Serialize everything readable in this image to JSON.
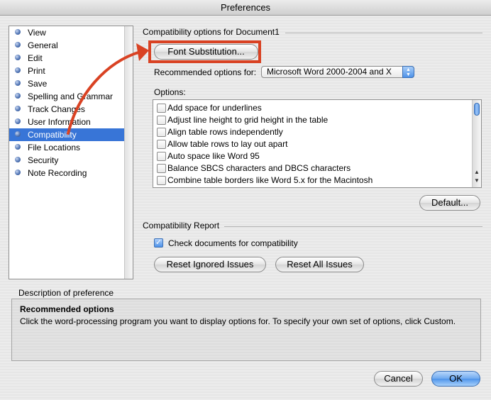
{
  "window": {
    "title": "Preferences"
  },
  "sidebar": {
    "items": [
      {
        "label": "View"
      },
      {
        "label": "General"
      },
      {
        "label": "Edit"
      },
      {
        "label": "Print"
      },
      {
        "label": "Save"
      },
      {
        "label": "Spelling and Grammar"
      },
      {
        "label": "Track Changes"
      },
      {
        "label": "User Information"
      },
      {
        "label": "Compatibility",
        "selected": true
      },
      {
        "label": "File Locations"
      },
      {
        "label": "Security"
      },
      {
        "label": "Note Recording"
      }
    ]
  },
  "compat": {
    "section_label": "Compatibility options for Document1",
    "font_sub_label": "Font Substitution...",
    "recommended_label": "Recommended options for:",
    "recommended_value": "Microsoft Word 2000-2004 and X",
    "options_label": "Options:",
    "options": [
      {
        "label": "Add space for underlines",
        "checked": false
      },
      {
        "label": "Adjust line height to grid height in the table",
        "checked": false
      },
      {
        "label": "Align table rows independently",
        "checked": false
      },
      {
        "label": "Allow table rows to lay out apart",
        "checked": false
      },
      {
        "label": "Auto space like Word 95",
        "checked": false
      },
      {
        "label": "Balance SBCS characters and DBCS characters",
        "checked": false
      },
      {
        "label": "Combine table borders like Word 5.x for the Macintosh",
        "checked": false
      }
    ],
    "default_label": "Default..."
  },
  "report": {
    "section_label": "Compatibility Report",
    "check_label": "Check documents for compatibility",
    "check_checked": true,
    "reset_ignored_label": "Reset Ignored Issues",
    "reset_all_label": "Reset All Issues"
  },
  "description": {
    "label": "Description of preference",
    "title": "Recommended options",
    "text": "Click the word-processing program you want to display options for. To specify your own set of options, click Custom."
  },
  "footer": {
    "cancel_label": "Cancel",
    "ok_label": "OK"
  },
  "colors": {
    "selection": "#3875d7",
    "annotation": "#d94223",
    "default_button": "#4e94ea"
  }
}
